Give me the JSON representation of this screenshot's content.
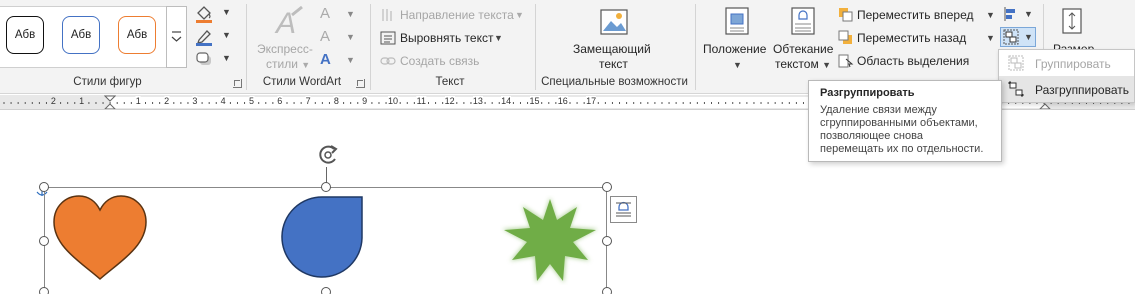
{
  "ribbon": {
    "shape_styles": {
      "label": "Стили фигур",
      "tiles": [
        {
          "label": "Абв",
          "border": "#111111"
        },
        {
          "label": "Абв",
          "border": "#4472c4"
        },
        {
          "label": "Абв",
          "border": "#ed7d31"
        }
      ],
      "fill_icon": "paint-bucket-icon",
      "outline_icon": "pen-icon",
      "effects_icon": "shape-effects-icon",
      "colors": {
        "fill": "#ed7d31",
        "outline": "#4472c4"
      }
    },
    "wordart": {
      "label": "Стили WordArt",
      "express_line1": "Экспресс-",
      "express_line2": "стили",
      "text_fill_glyph": "A",
      "text_outline_glyph": "A",
      "text_effects_glyph": "A"
    },
    "text_group": {
      "label": "Текст",
      "direction": "Направление текста",
      "align": "Выровнять текст",
      "link": "Создать связь"
    },
    "accessibility": {
      "label": "Специальные возможности",
      "alt_text_line1": "Замещающий",
      "alt_text_line2": "текст"
    },
    "arrange": {
      "position": "Положение",
      "wrap_line1": "Обтекание",
      "wrap_line2": "текстом",
      "bring_forward": "Переместить вперед",
      "send_backward": "Переместить назад",
      "selection_pane": "Область выделения"
    },
    "size": {
      "label_line1": "Размер"
    }
  },
  "ruler": {
    "numbers": [
      "2",
      "1",
      "1",
      "2",
      "3",
      "4",
      "5",
      "6",
      "7",
      "8",
      "9",
      "10",
      "11",
      "12",
      "13",
      "14",
      "15",
      "16",
      "17"
    ]
  },
  "group_menu": {
    "group": "Группировать",
    "ungroup": "Разгруппировать"
  },
  "tooltip": {
    "title": "Разгруппировать",
    "line1": "Удаление связи между",
    "line2": "сгруппированными объектами,",
    "line3": "позволяющее снова",
    "line4": "перемещать их по отдельности."
  },
  "shapes": {
    "heart_color": "#ed7d31",
    "drop_color": "#4472c4",
    "star_color": "#70ad47"
  }
}
